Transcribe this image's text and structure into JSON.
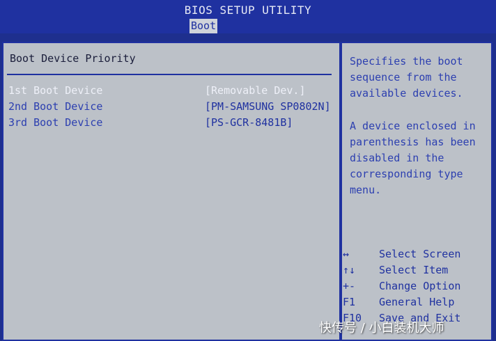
{
  "header": {
    "title": "BIOS SETUP UTILITY",
    "active_tab": "Boot"
  },
  "main": {
    "section_title": "Boot Device Priority",
    "boot_devices": [
      {
        "label": "1st Boot Device",
        "value": "[Removable Dev.]",
        "selected": true
      },
      {
        "label": "2nd Boot Device",
        "value": "[PM-SAMSUNG SP0802N]",
        "selected": false
      },
      {
        "label": "3rd Boot Device",
        "value": "[PS-GCR-8481B]",
        "selected": false
      }
    ]
  },
  "help": {
    "paragraph1": [
      "Specifies the boot",
      "sequence from the",
      "available devices."
    ],
    "paragraph2": [
      "A device enclosed in",
      "parenthesis has been",
      "disabled in the",
      "corresponding type",
      "menu."
    ]
  },
  "keys": [
    {
      "key": "↔",
      "desc": "Select Screen",
      "icon": "left-right-arrow-icon"
    },
    {
      "key": "↑↓",
      "desc": "Select Item",
      "icon": "up-down-arrow-icon"
    },
    {
      "key": "+-",
      "desc": "Change Option",
      "icon": "plus-minus-icon"
    },
    {
      "key": "F1",
      "desc": "General Help",
      "icon": ""
    },
    {
      "key": "F10",
      "desc": "Save and Exit",
      "icon": ""
    }
  ],
  "watermark": "快传号 / 小白装机大师",
  "colors": {
    "background": "#1e2f8e",
    "panel": "#bcc1c8",
    "accent": "#1f31a0",
    "selected_text": "#eef0f8"
  }
}
